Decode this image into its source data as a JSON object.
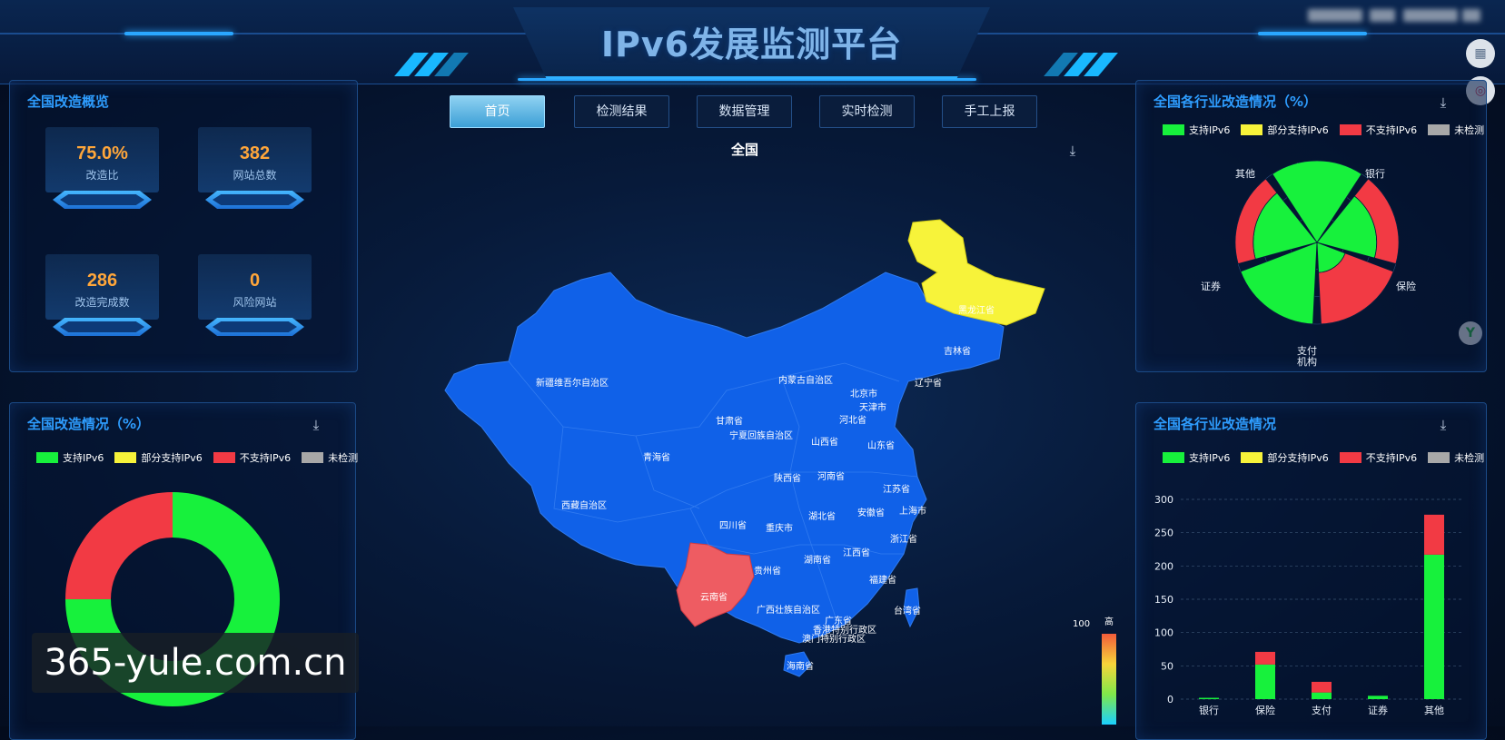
{
  "header": {
    "title": "IPv6发展监测平台"
  },
  "nav": [
    "首页",
    "检测结果",
    "数据管理",
    "实时检测",
    "手工上报"
  ],
  "overview": {
    "title": "全国改造概览",
    "stats": [
      {
        "value": "75.0%",
        "label": "改造比"
      },
      {
        "value": "382",
        "label": "网站总数"
      },
      {
        "value": "286",
        "label": "改造完成数"
      },
      {
        "value": "0",
        "label": "风险网站"
      }
    ]
  },
  "legend": [
    "支持IPv6",
    "部分支持IPv6",
    "不支持IPv6",
    "未检测"
  ],
  "colors": {
    "support": "#17f13c",
    "partial": "#f7f33a",
    "unsupported": "#f23a44",
    "untested": "#a8a8a8",
    "map": "#1061e8"
  },
  "national": {
    "title": "全国改造情况（%）",
    "chart_data": {
      "type": "pie",
      "labels": [
        "支持IPv6",
        "部分支持IPv6",
        "不支持IPv6",
        "未检测"
      ],
      "values": [
        75.0,
        0,
        25.0,
        0
      ]
    }
  },
  "map": {
    "title": "全国",
    "scale_max": "100",
    "scale_label": "高",
    "provinces": {
      "xinjiang": "新疆维吾尔自治区",
      "xizang": "西藏自治区",
      "qinghai": "青海省",
      "gansu": "甘肃省",
      "neimenggu": "内蒙古自治区",
      "ningxia": "宁夏回族自治区",
      "shanxi": "山西省",
      "shaanxi": "陕西省",
      "sichuan": "四川省",
      "chongqing": "重庆市",
      "yunnan": "云南省",
      "guizhou": "贵州省",
      "guangxi": "广西壮族自治区",
      "guangdong": "广东省",
      "hainan": "海南省",
      "hongkong": "香港特别行政区",
      "macao": "澳门特别行政区",
      "taiwan": "台湾省",
      "fujian": "福建省",
      "jiangxi": "江西省",
      "hunan": "湖南省",
      "hubei": "湖北省",
      "henan": "河南省",
      "anhui": "安徽省",
      "zhejiang": "浙江省",
      "shanghai": "上海市",
      "jiangsu": "江苏省",
      "shandong": "山东省",
      "hebei": "河北省",
      "beijing": "北京市",
      "tianjin": "天津市",
      "liaoning": "辽宁省",
      "jilin": "吉林省",
      "heilongjiang": "黑龙江省"
    }
  },
  "industry_rose": {
    "title": "全国各行业改造情况（%）",
    "chart_data": {
      "type": "pie",
      "categories": [
        "银行",
        "保险",
        "支付\n机构",
        "证券",
        "其他"
      ],
      "category_labels": [
        "银行",
        "保险",
        "支付",
        "机构",
        "证券",
        "其他"
      ],
      "series": [
        {
          "name": "支持IPv6",
          "values": [
            100,
            73,
            37,
            100,
            78
          ]
        },
        {
          "name": "部分支持IPv6",
          "values": [
            0,
            0,
            0,
            0,
            0
          ]
        },
        {
          "name": "不支持IPv6",
          "values": [
            0,
            27,
            63,
            0,
            22
          ]
        },
        {
          "name": "未检测",
          "values": [
            0,
            0,
            0,
            0,
            0
          ]
        }
      ],
      "radial_max": "1"
    }
  },
  "industry_bar": {
    "title": "全国各行业改造情况",
    "chart_data": {
      "type": "bar",
      "categories": [
        "银行",
        "保险",
        "支付",
        "证券",
        "其他"
      ],
      "series": [
        {
          "name": "支持IPv6",
          "values": [
            2,
            52,
            10,
            5,
            217
          ]
        },
        {
          "name": "不支持IPv6",
          "values": [
            0,
            19,
            16,
            0,
            60
          ]
        }
      ],
      "ylim": [
        0,
        300
      ],
      "yticks": [
        "0",
        "50",
        "100",
        "150",
        "200",
        "250",
        "300"
      ]
    }
  },
  "watermark": "365-yule.com.cn"
}
